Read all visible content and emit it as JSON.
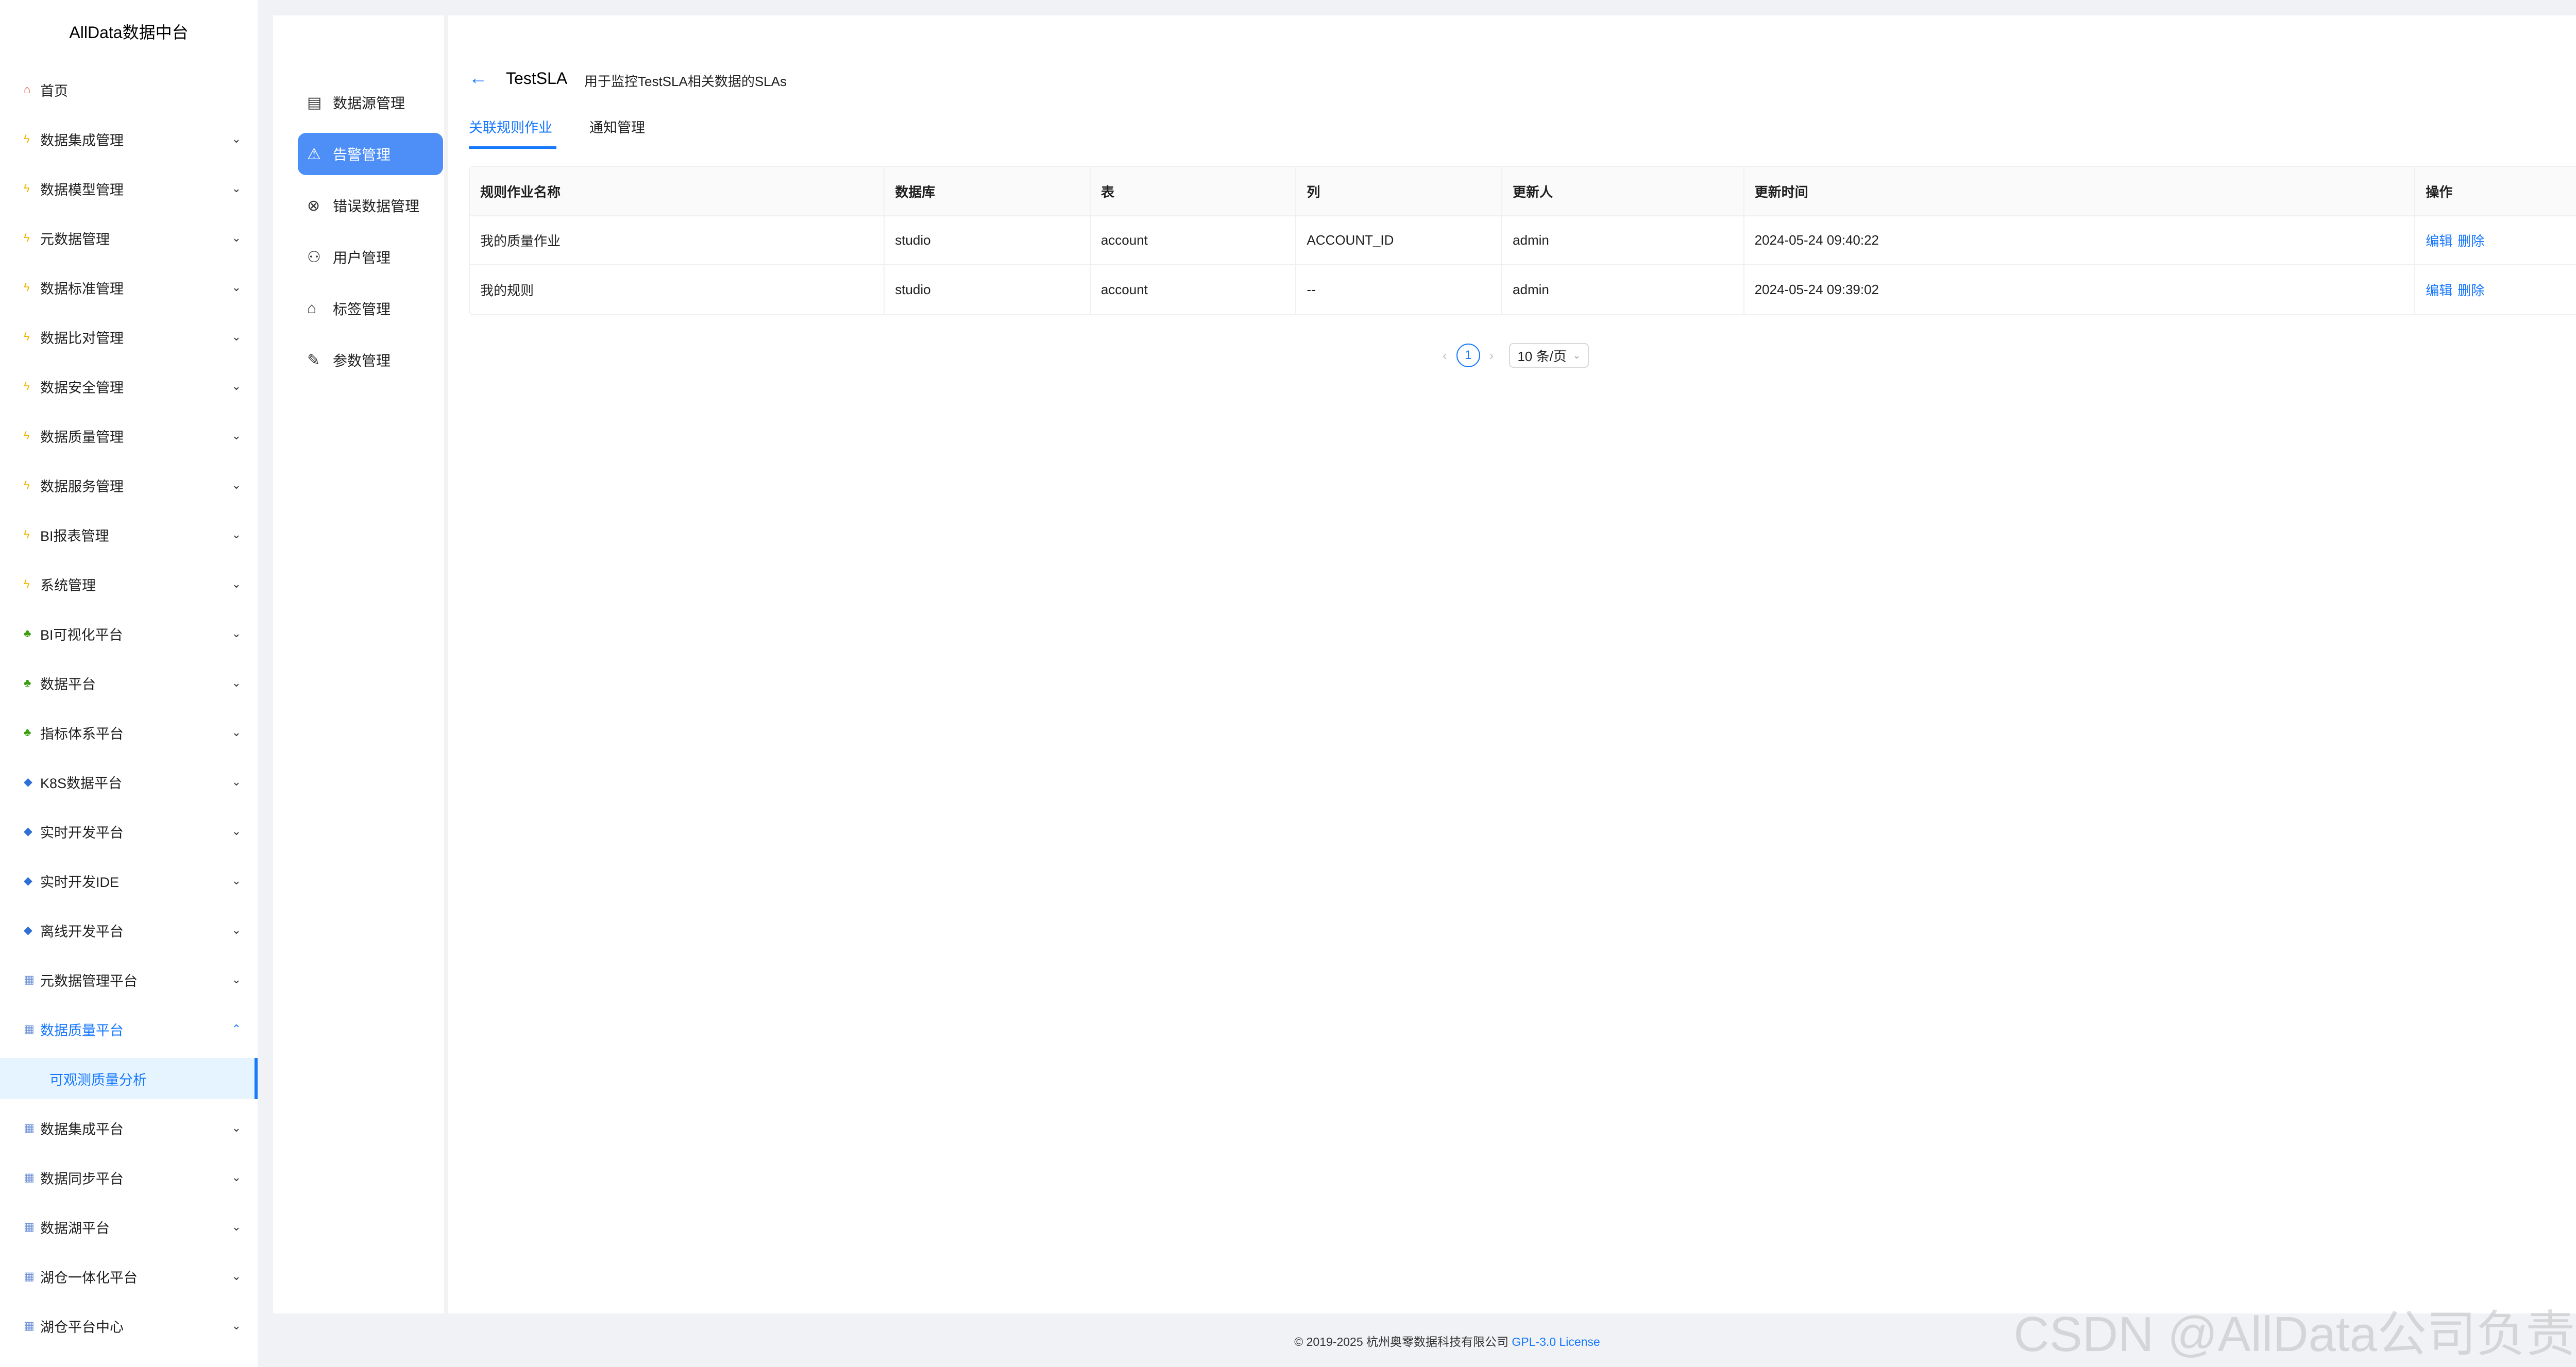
{
  "app": {
    "title": "AllData数据中台"
  },
  "sidebar": {
    "items": [
      {
        "label": "首页",
        "icon": "home-icon"
      },
      {
        "label": "数据集成管理",
        "icon": "bolt-icon"
      },
      {
        "label": "数据模型管理",
        "icon": "bolt-icon"
      },
      {
        "label": "元数据管理",
        "icon": "bolt-icon"
      },
      {
        "label": "数据标准管理",
        "icon": "bolt-icon"
      },
      {
        "label": "数据比对管理",
        "icon": "bolt-icon"
      },
      {
        "label": "数据安全管理",
        "icon": "bolt-icon"
      },
      {
        "label": "数据质量管理",
        "icon": "bolt-icon"
      },
      {
        "label": "数据服务管理",
        "icon": "bolt-icon"
      },
      {
        "label": "BI报表管理",
        "icon": "bolt-icon"
      },
      {
        "label": "系统管理",
        "icon": "bolt-icon"
      },
      {
        "label": "BI可视化平台",
        "icon": "plant-icon"
      },
      {
        "label": "数据平台",
        "icon": "plant-icon"
      },
      {
        "label": "指标体系平台",
        "icon": "plant-icon"
      },
      {
        "label": "K8S数据平台",
        "icon": "gem-icon"
      },
      {
        "label": "实时开发平台",
        "icon": "gem-icon"
      },
      {
        "label": "实时开发IDE",
        "icon": "gem-icon"
      },
      {
        "label": "离线开发平台",
        "icon": "gem-icon"
      },
      {
        "label": "元数据管理平台",
        "icon": "grid-icon"
      },
      {
        "label": "数据质量平台",
        "icon": "grid-icon"
      },
      {
        "label": "数据集成平台",
        "icon": "grid-icon"
      },
      {
        "label": "数据同步平台",
        "icon": "grid-icon"
      },
      {
        "label": "数据湖平台",
        "icon": "grid-icon"
      },
      {
        "label": "湖仓一体化平台",
        "icon": "grid-icon"
      },
      {
        "label": "湖仓平台中心",
        "icon": "grid-icon"
      }
    ],
    "active_sub": {
      "label": "可观测质量分析"
    }
  },
  "subnav": {
    "items": [
      {
        "label": "数据源管理",
        "icon": "database-icon"
      },
      {
        "label": "告警管理",
        "icon": "warning-icon"
      },
      {
        "label": "错误数据管理",
        "icon": "error-icon"
      },
      {
        "label": "用户管理",
        "icon": "user-icon"
      },
      {
        "label": "标签管理",
        "icon": "tag-icon"
      },
      {
        "label": "参数管理",
        "icon": "edit-icon"
      }
    ]
  },
  "header": {
    "title": "TestSLA",
    "description": "用于监控TestSLA相关数据的SLAs"
  },
  "tabs": [
    {
      "label": "关联规则作业"
    },
    {
      "label": "通知管理"
    }
  ],
  "table": {
    "columns": [
      "规则作业名称",
      "数据库",
      "表",
      "列",
      "更新人",
      "更新时间",
      "操作"
    ],
    "rows": [
      {
        "name": "我的质量作业",
        "database": "studio",
        "table": "account",
        "column": "ACCOUNT_ID",
        "updater": "admin",
        "updated_at": "2024-05-24 09:40:22",
        "edit": "编辑",
        "delete": "删除"
      },
      {
        "name": "我的规则",
        "database": "studio",
        "table": "account",
        "column": "--",
        "updater": "admin",
        "updated_at": "2024-05-24 09:39:02",
        "edit": "编辑",
        "delete": "删除"
      }
    ]
  },
  "pagination": {
    "current_page": "1",
    "page_size": "10 条/页"
  },
  "footer": {
    "copyright": "© 2019-2025 杭州奥零数据科技有限公司",
    "license": "GPL-3.0 License"
  },
  "watermark": "CSDN @AllData公司负责人",
  "colors": {
    "accent": "#1677ff",
    "active_subnav": "#4d8ff7",
    "page_bg": "#f0f2f5"
  }
}
